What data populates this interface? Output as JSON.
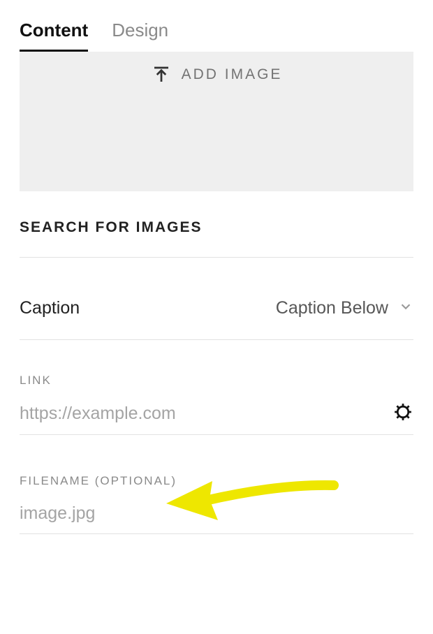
{
  "tabs": {
    "content": "Content",
    "design": "Design"
  },
  "addImage": {
    "label": "ADD IMAGE"
  },
  "search": {
    "label": "SEARCH FOR IMAGES"
  },
  "caption": {
    "label": "Caption",
    "selected": "Caption Below"
  },
  "link": {
    "label": "LINK",
    "placeholder": "https://example.com",
    "value": ""
  },
  "filename": {
    "label": "FILENAME (OPTIONAL)",
    "placeholder": "image.jpg",
    "value": ""
  }
}
